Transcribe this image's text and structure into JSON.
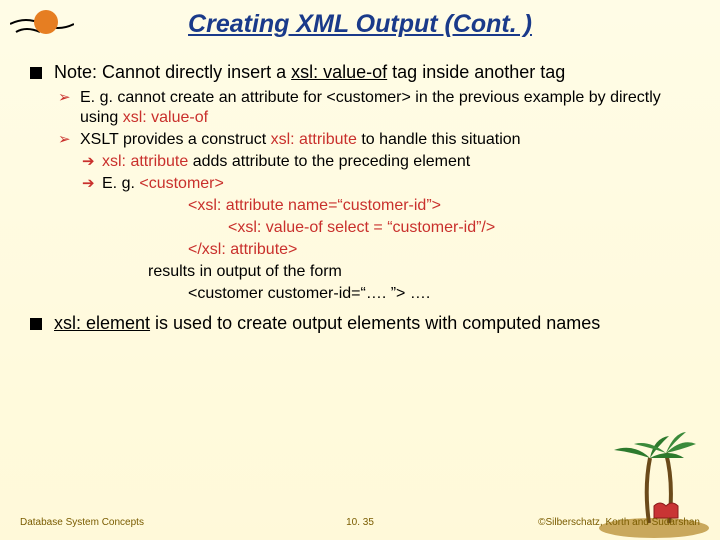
{
  "title": "Creating XML Output (Cont. )",
  "bullets": {
    "p1": {
      "pre": "Note: Cannot directly insert a ",
      "code": "xsl: value-of",
      "post": " tag inside another tag"
    },
    "s1": {
      "pre": "E. g. cannot create an attribute for <customer> in the previous example by directly using ",
      "code": "xsl: value-of"
    },
    "s2": {
      "pre": "XSLT provides a construct  ",
      "code": "xsl: attribute",
      "post": " to handle this situation"
    },
    "s2a": {
      "code": "xsl: attribute",
      "post": " adds attribute to the preceding element"
    },
    "s2b_pre": "E. g.  ",
    "s2b_code": "<customer>",
    "s2b_l2": "<xsl: attribute name=“customer-id”>",
    "s2b_l3": "<xsl: value-of select = “customer-id”/>",
    "s2b_l4": "</xsl: attribute>",
    "s2b_res": "results in output of the form",
    "s2b_out": "<customer  customer-id=“…. ”> ….",
    "p2": {
      "code": "xsl: element",
      "post": " is used to create output elements with computed names"
    }
  },
  "footer": {
    "left": "Database System Concepts",
    "center": "10. 35",
    "right": "©Silberschatz, Korth and Sudarshan"
  }
}
